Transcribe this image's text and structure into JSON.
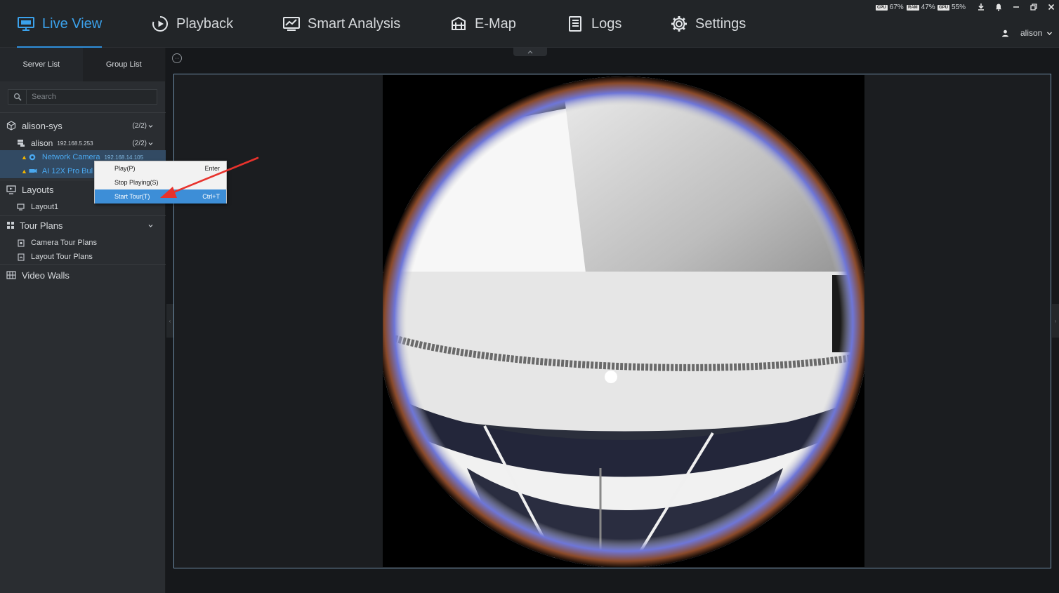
{
  "nav": {
    "items": [
      {
        "label": "Live View",
        "icon": "monitor-icon",
        "active": true
      },
      {
        "label": "Playback",
        "icon": "play-circle-icon"
      },
      {
        "label": "Smart Analysis",
        "icon": "chart-monitor-icon"
      },
      {
        "label": "E-Map",
        "icon": "map-icon"
      },
      {
        "label": "Logs",
        "icon": "document-list-icon"
      },
      {
        "label": "Settings",
        "icon": "gear-icon"
      }
    ]
  },
  "system": {
    "cpu_label": "CPU",
    "cpu": "67%",
    "ram_label": "RAM",
    "ram": "47%",
    "gpu_label": "GPU",
    "gpu": "55%"
  },
  "user": {
    "name": "alison"
  },
  "left_panel": {
    "tabs": [
      "Server List",
      "Group List"
    ],
    "search_placeholder": "Search",
    "tree": {
      "root": {
        "label": "alison-sys",
        "count": "(2/2)"
      },
      "server": {
        "label": "alison",
        "ip": "192.168.5.253",
        "count": "(2/2)"
      },
      "cameras": [
        {
          "label": "Network Camera",
          "ip": "192.168.14.105"
        },
        {
          "label": "AI 12X Pro Bul"
        }
      ],
      "layouts": {
        "label": "Layouts",
        "children": [
          "Layout1"
        ]
      },
      "tour_plans": {
        "label": "Tour Plans",
        "children": [
          "Camera Tour Plans",
          "Layout Tour Plans"
        ]
      },
      "video_walls": {
        "label": "Video Walls"
      }
    }
  },
  "context_menu": {
    "items": [
      {
        "label": "Play(P)",
        "shortcut": "Enter"
      },
      {
        "label": "Stop Playing(S)",
        "shortcut": ""
      },
      {
        "label": "Start Tour(T)",
        "shortcut": "Ctrl+T",
        "highlighted": true
      }
    ]
  },
  "colors": {
    "accent": "#3ba2ec",
    "menu_highlight": "#3d8ed7",
    "annotation_arrow": "#e8322c",
    "warning": "#f0b400"
  }
}
